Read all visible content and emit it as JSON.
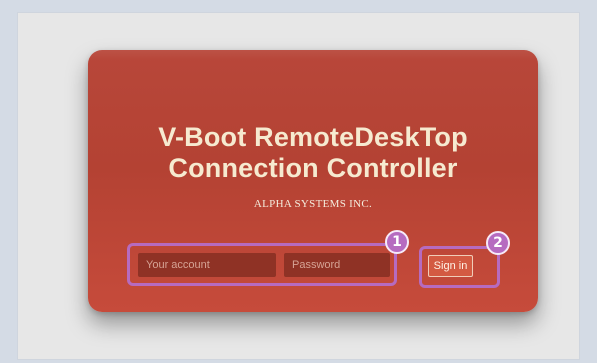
{
  "app": {
    "title_line1": "V-Boot RemoteDeskTop",
    "title_line2": "Connection Controller",
    "company": "ALPHA SYSTEMS INC."
  },
  "login": {
    "account_placeholder": "Your account",
    "password_placeholder": "Password",
    "signin_label": "Sign in"
  },
  "annotations": {
    "badge_1": "1",
    "badge_2": "2",
    "highlight_color": "#b66bc0"
  },
  "colors": {
    "card": "#b8473a",
    "field_bg": "#8f3225",
    "title_text": "#f6ead0",
    "button_bg": "#d35a42"
  }
}
